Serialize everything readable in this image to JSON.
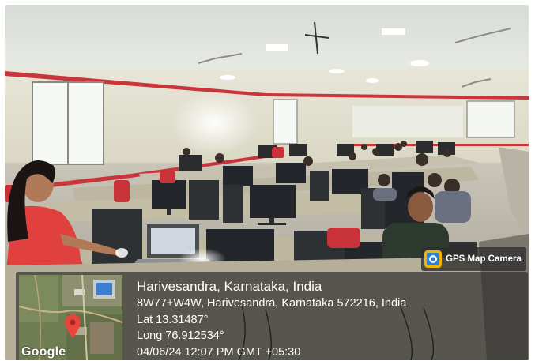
{
  "gps": {
    "badge_label": "GPS Map Camera",
    "title": "Harivesandra, Karnataka, India",
    "address": "8W77+W4W, Harivesandra, Karnataka 572216, India",
    "latitude": "Lat 13.31487°",
    "longitude": "Long 76.912534°",
    "timestamp": "04/06/24 12:07 PM GMT +05:30",
    "map_logo": "Google"
  },
  "colors": {
    "overlay": "#2d2d2d",
    "pin": "#e8463a",
    "badge_icon": "#f2b400",
    "wall_stripe": "#c8353a"
  },
  "icons": {
    "badge": "gps-map-camera-icon",
    "pin": "map-pin-icon"
  }
}
